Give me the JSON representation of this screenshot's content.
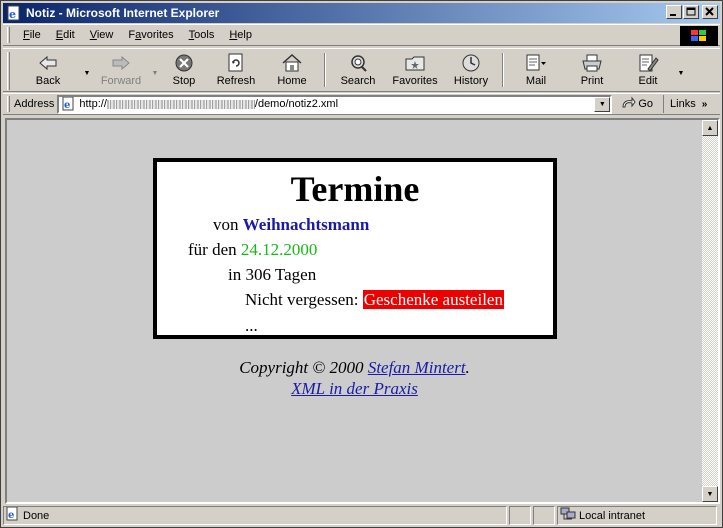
{
  "window": {
    "title": "Notiz - Microsoft Internet Explorer",
    "buttons": {
      "minimize": "_",
      "maximize": "□",
      "close": "×"
    }
  },
  "menu": [
    {
      "label": "File",
      "accel": "F",
      "rest": "ile"
    },
    {
      "label": "Edit",
      "accel": "E",
      "rest": "dit"
    },
    {
      "label": "View",
      "accel": "V",
      "rest": "iew"
    },
    {
      "label": "Favorites",
      "accel": "a",
      "pre": "F",
      "rest": "vorites"
    },
    {
      "label": "Tools",
      "accel": "T",
      "rest": "ools"
    },
    {
      "label": "Help",
      "accel": "H",
      "rest": "elp"
    }
  ],
  "toolbar": {
    "back": "Back",
    "forward": "Forward",
    "stop": "Stop",
    "refresh": "Refresh",
    "home": "Home",
    "search": "Search",
    "favorites": "Favorites",
    "history": "History",
    "mail": "Mail",
    "print": "Print",
    "edit": "Edit"
  },
  "address": {
    "label": "Address",
    "url_prefix": "http://",
    "url_suffix": "/demo/notiz2.xml",
    "go": "Go",
    "links": "Links",
    "chevron": "»"
  },
  "page": {
    "title": "Termine",
    "von_label": "von",
    "von_name": "Weihnachtsmann",
    "fuer_label": "für den",
    "date": "24.12.2000",
    "in_label": "in",
    "days": "306 Tagen",
    "reminder_label": "Nicht vergessen:",
    "reminder_text": "Geschenke austeilen",
    "ellipsis": "...",
    "copyright_prefix": "Copyright © 2000",
    "copyright_author": "Stefan Mintert",
    "copyright_suffix": ".",
    "book_link": "XML in der Praxis"
  },
  "status": {
    "text": "Done",
    "zone": "Local intranet"
  },
  "colors": {
    "link": "#1a1aa8",
    "date": "#18b818",
    "reminder_bg": "#ee0000",
    "title_bar_start": "#0a246a",
    "title_bar_end": "#a6caf0"
  }
}
